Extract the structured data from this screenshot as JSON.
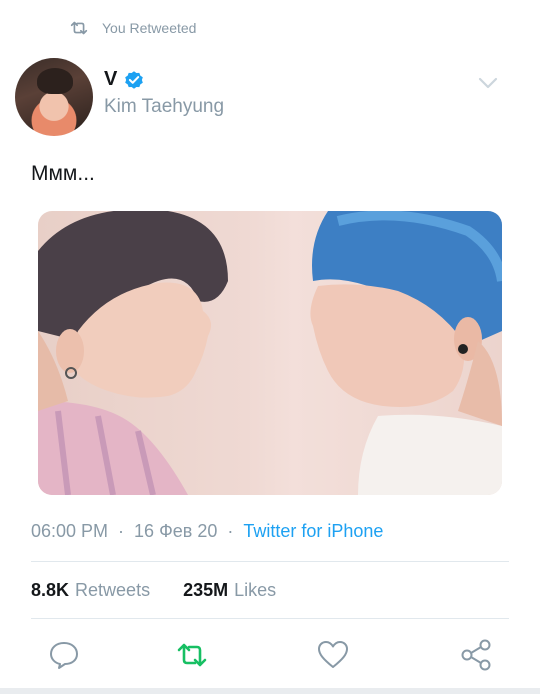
{
  "retweet_context": {
    "text": "You Retweeted"
  },
  "author": {
    "display_name": "V",
    "handle": "Kim Taehyung",
    "verified": true
  },
  "tweet": {
    "text": "Ммм..."
  },
  "meta": {
    "time": "06:00 PM",
    "separator": "·",
    "date": "16 Фев 20",
    "source": "Twitter for iPhone"
  },
  "stats": {
    "retweets_count": "8.8K",
    "retweets_label": "Retweets",
    "likes_count": "235M",
    "likes_label": "Likes"
  },
  "actions": {
    "reply_icon": "speech-bubble-icon",
    "retweet_icon": "retweet-icon",
    "like_icon": "heart-icon",
    "share_icon": "share-icon",
    "retweet_active": true
  },
  "colors": {
    "verified_blue": "#1da1f2",
    "link_blue": "#1da1f2",
    "retweet_green": "#17bf63",
    "muted_gray": "#8899a6"
  }
}
